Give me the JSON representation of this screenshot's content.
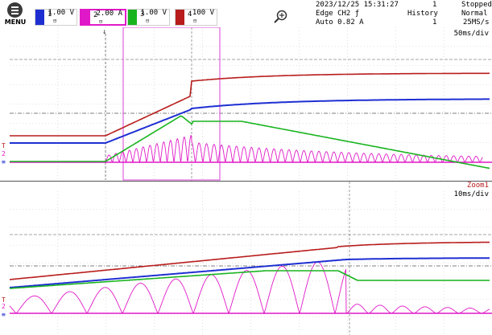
{
  "menu": {
    "label": "MENU"
  },
  "channels": [
    {
      "num": "1",
      "value": "1.00 V",
      "color": "#1e2fd2"
    },
    {
      "num": "2",
      "value": "2.00 A",
      "color": "#e019c8"
    },
    {
      "num": "3",
      "value": "1.00 V",
      "color": "#18b41e"
    },
    {
      "num": "4",
      "value": "100 V",
      "color": "#b81c1c"
    }
  ],
  "status": {
    "datetime": "2023/12/25 15:31:27",
    "count": "1",
    "state": "Stopped",
    "trigger_type": "Edge CH2 ƒ",
    "trigger_mode": "Auto 0.82 A",
    "history_label": "History",
    "history_value": "1",
    "acq_mode": "Normal",
    "sample_rate": "25MS/s"
  },
  "main_plot": {
    "timebase": "50ms/div"
  },
  "zoom_plot": {
    "title": "Zoom1",
    "timebase": "10ms/div"
  },
  "colors": {
    "ch1": "#1e2fd2",
    "ch2": "#e019c8",
    "ch3": "#18b41e",
    "ch4": "#b81c1c",
    "zoom_box": "#e060e0"
  }
}
